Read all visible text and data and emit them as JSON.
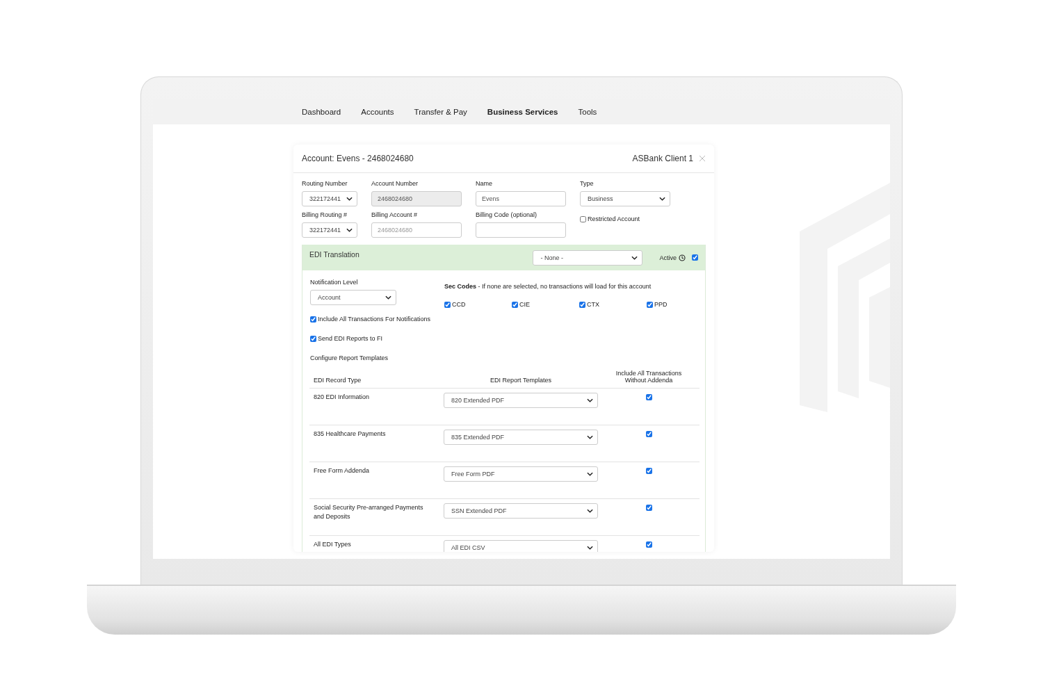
{
  "nav": [
    {
      "label": "Dashboard",
      "selected": false
    },
    {
      "label": "Accounts",
      "selected": false
    },
    {
      "label": "Transfer & Pay",
      "selected": false
    },
    {
      "label": "Business Services",
      "selected": true
    },
    {
      "label": "Tools",
      "selected": false
    }
  ],
  "account": {
    "title": "Account: Evens - 2468024680",
    "client": "ASBank Client 1"
  },
  "fields": [
    {
      "kind": "select",
      "label": "Routing Number",
      "value": "322172441"
    },
    {
      "kind": "input",
      "label": "Account Number",
      "value": "2468024680",
      "disabled": true
    },
    {
      "kind": "input",
      "label": "Name",
      "value": "Evens",
      "disabled": false
    },
    {
      "kind": "select",
      "label": "Type",
      "value": "Business"
    },
    {
      "kind": "select",
      "label": "Billing Routing #",
      "value": "322172441"
    },
    {
      "kind": "input",
      "label": "Billing Account #",
      "placeholder": "2468024680",
      "disabled": false
    },
    {
      "kind": "input",
      "label": "Billing Code (optional)",
      "disabled": false
    },
    {
      "kind": "checkbox",
      "label": "Restricted Account",
      "checked": false
    }
  ],
  "edi": {
    "title": "EDI Translation",
    "select": "- None -",
    "active_label": "Active",
    "active": true,
    "notification_label": "Notification Level",
    "notification_value": "Account",
    "sec_codes_note": "**Sec Codes** - If none are selected, no transactions will load for this account",
    "sec_codes": [
      {
        "label": "CCD",
        "checked": true
      },
      {
        "label": "CIE",
        "checked": true
      },
      {
        "label": "CTX",
        "checked": true
      },
      {
        "label": "PPD",
        "checked": true
      }
    ],
    "options": [
      {
        "label": "Include All Transactions For Notifications",
        "checked": true
      },
      {
        "label": "Send EDI Reports to FI",
        "checked": true
      }
    ],
    "configure_heading": "Configure Report Templates",
    "table": {
      "columns": [
        "EDI Record Type",
        "EDI Report Templates",
        "Include All Transactions Without Addenda"
      ],
      "rows": [
        {
          "record_type": "820 EDI Information",
          "template": "820 Extended PDF",
          "checked": true
        },
        {
          "record_type": "835 Healthcare Payments",
          "template": "835 Extended PDF",
          "checked": true
        },
        {
          "record_type": "Free Form Addenda",
          "template": "Free Form PDF",
          "checked": true
        },
        {
          "record_type": "Social Security Pre-arranged Payments and Deposits",
          "template": "SSN Extended PDF",
          "checked": true
        },
        {
          "record_type": "All EDI Types",
          "template": "All EDI CSV",
          "checked": true
        }
      ]
    }
  }
}
